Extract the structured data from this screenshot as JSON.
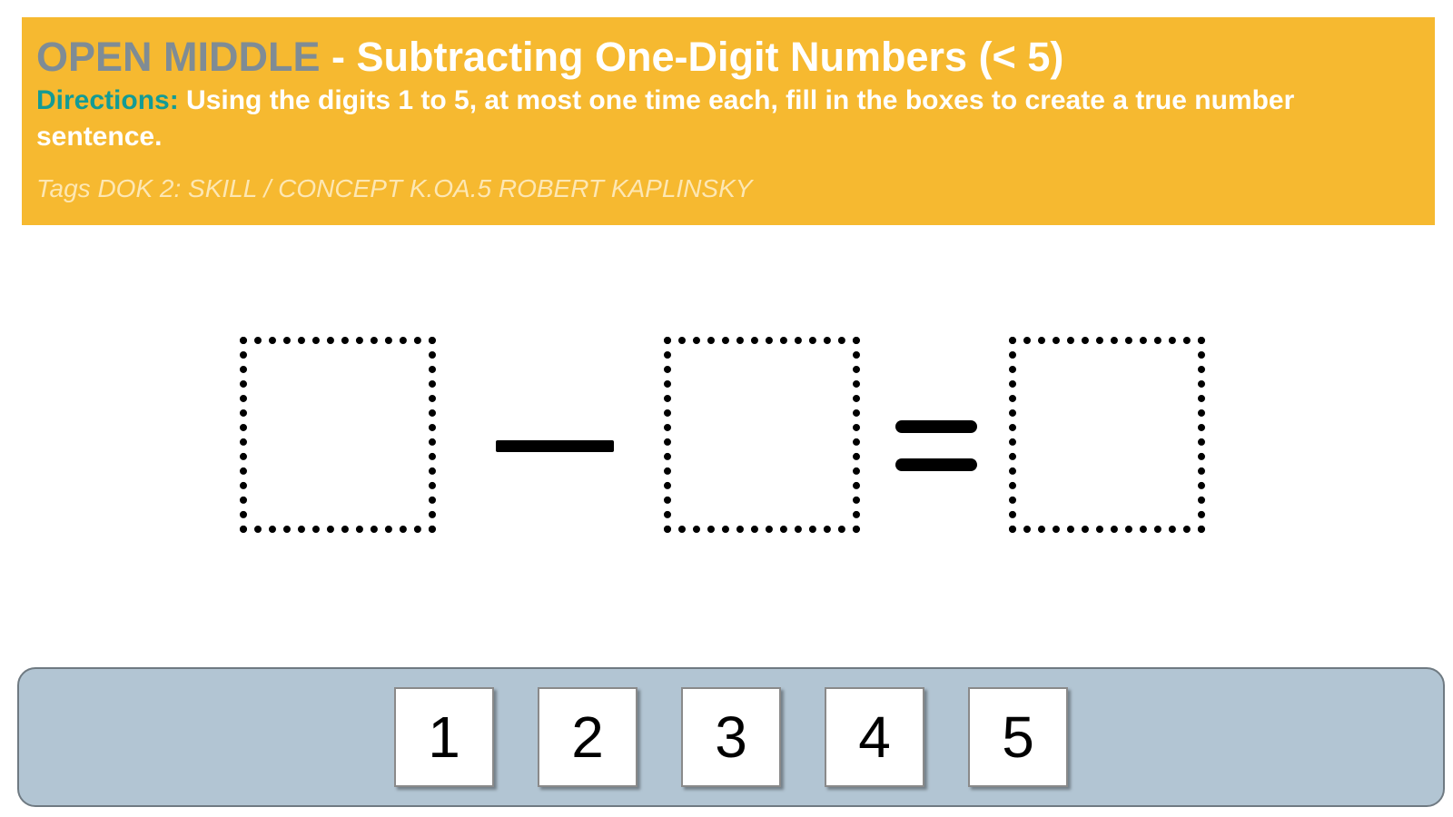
{
  "header": {
    "title_prefix": "OPEN MIDDLE",
    "title_rest": " - Subtracting One-Digit Numbers (< 5)",
    "directions_label": "Directions:",
    "directions_text": " Using the digits 1 to 5, at most one time each, fill in the boxes to create a true number sentence.",
    "tags": "Tags DOK 2: SKILL / CONCEPT K.OA.5 ROBERT KAPLINSKY"
  },
  "equation": {
    "boxes": [
      "",
      "",
      ""
    ],
    "operator": "minus",
    "result_operator": "equals"
  },
  "tray": {
    "digits": [
      "1",
      "2",
      "3",
      "4",
      "5"
    ]
  },
  "colors": {
    "banner": "#f6b930",
    "title_prefix": "#7f8c95",
    "directions_label": "#139b95",
    "tray": "#b2c5d3"
  }
}
